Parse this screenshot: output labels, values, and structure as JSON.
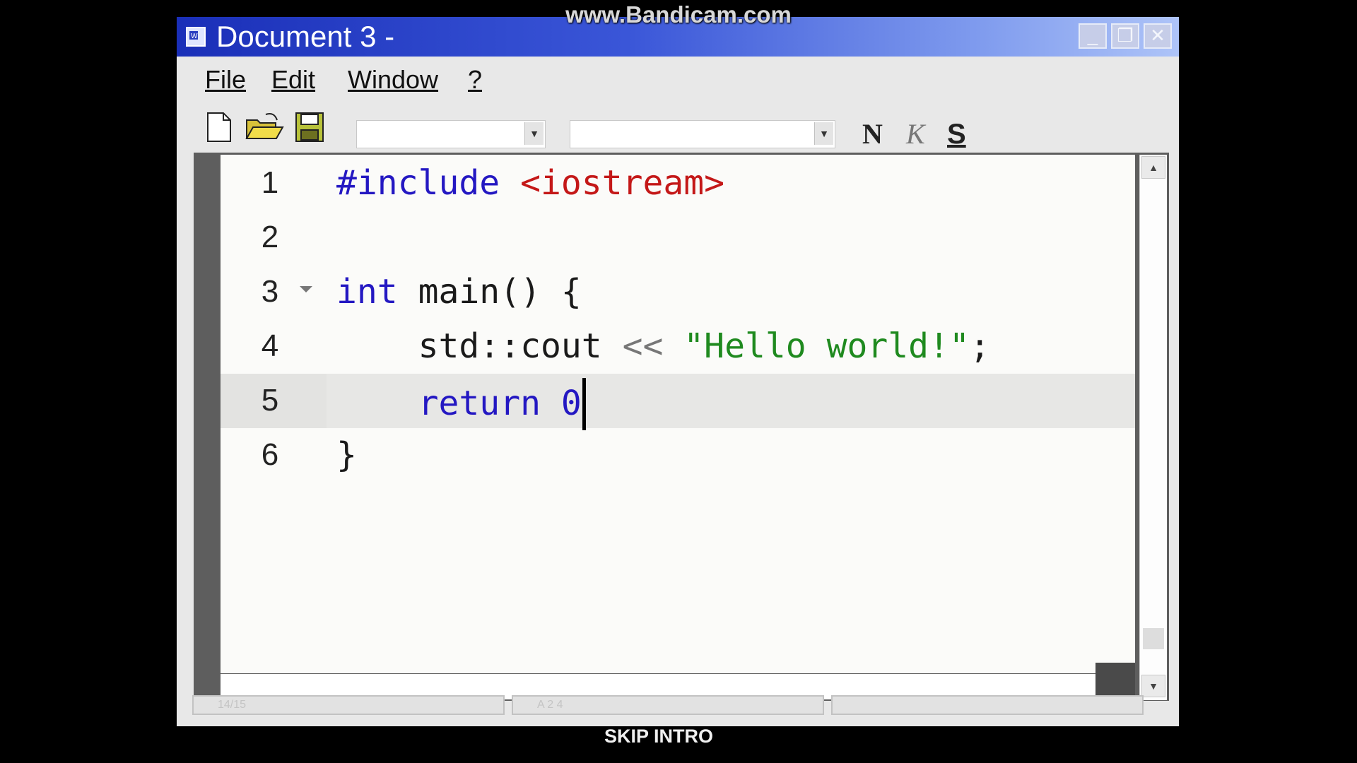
{
  "overlay": {
    "watermark": "www.Bandicam.com",
    "skip_intro": "SKIP INTRO"
  },
  "window": {
    "title": "Document 3 -",
    "buttons": {
      "minimize": "_",
      "restore": "❐",
      "close": "✕"
    }
  },
  "menu": {
    "items": [
      "File",
      "Edit",
      "Window",
      "?"
    ]
  },
  "toolbar": {
    "font_combo_value": "",
    "size_combo_value": "",
    "bold_label": "N",
    "italic_label": "K",
    "underline_label": "S"
  },
  "editor": {
    "current_line": 5,
    "lines": [
      {
        "number": "1",
        "text": "#include <iostream>"
      },
      {
        "number": "2",
        "text": ""
      },
      {
        "number": "3",
        "text": "int main() {"
      },
      {
        "number": "4",
        "text": "    std::cout << \"Hello world!\";"
      },
      {
        "number": "5",
        "text": "    return 0"
      },
      {
        "number": "6",
        "text": "}"
      }
    ],
    "tokens": {
      "l1_include": "#include",
      "l1_header": "<iostream>",
      "l3_int": "int",
      "l3_rest": " main() {",
      "l4_indent": "    ",
      "l4_cout": "std::cout ",
      "l4_op": "<<",
      "l4_str": "\"Hello world!\"",
      "l4_semi": ";",
      "l5_indent": "    ",
      "l5_return": "return 0",
      "l6_brace": "}"
    }
  },
  "statusbar": {
    "cells": [
      "14/15",
      "A 2 4",
      ""
    ]
  },
  "colors": {
    "keyword": "#2418c2",
    "include": "#c41818",
    "string": "#1f8a1f",
    "titlebar_start": "#1a2fb8",
    "titlebar_end": "#aec4f8"
  },
  "icons": [
    "document-icon",
    "new-file-icon",
    "open-folder-icon",
    "save-icon",
    "chevron-down-icon",
    "fold-arrow-icon",
    "scroll-up-icon",
    "scroll-down-icon"
  ]
}
